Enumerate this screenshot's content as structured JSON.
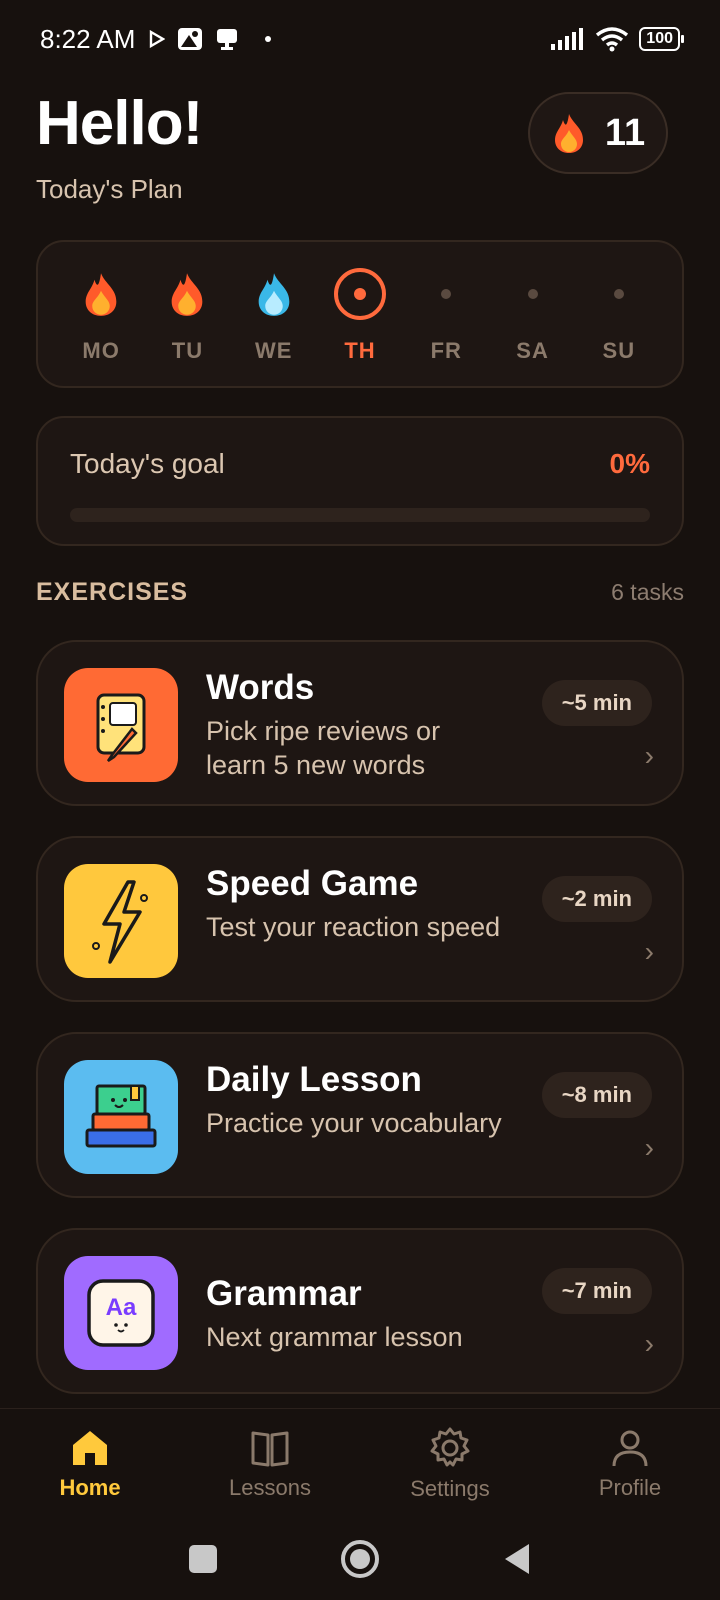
{
  "status_bar": {
    "time": "8:22 AM",
    "battery": "100"
  },
  "header": {
    "greeting": "Hello!",
    "subtitle": "Today's Plan",
    "streak_count": "11"
  },
  "week": {
    "days": [
      {
        "label": "MO",
        "state": "fire"
      },
      {
        "label": "TU",
        "state": "fire"
      },
      {
        "label": "WE",
        "state": "frozen"
      },
      {
        "label": "TH",
        "state": "today"
      },
      {
        "label": "FR",
        "state": "upcoming"
      },
      {
        "label": "SA",
        "state": "upcoming"
      },
      {
        "label": "SU",
        "state": "upcoming"
      }
    ]
  },
  "goal": {
    "label": "Today's goal",
    "percent_text": "0%",
    "progress": 0
  },
  "exercises_section": {
    "title": "EXERCISES",
    "count": "6 tasks"
  },
  "exercises": [
    {
      "name": "Words",
      "desc": "Pick ripe reviews or learn 5 new words",
      "time": "~5 min",
      "icon": "notebook-pencil-icon",
      "color": "#ff6a34"
    },
    {
      "name": "Speed Game",
      "desc": "Test your reaction speed",
      "time": "~2 min",
      "icon": "lightning-icon",
      "color": "#ffc83d"
    },
    {
      "name": "Daily Lesson",
      "desc": "Practice your vocabulary",
      "time": "~8 min",
      "icon": "book-stack-icon",
      "color": "#5bbcf0"
    },
    {
      "name": "Grammar",
      "desc": "Next grammar lesson",
      "time": "~7 min",
      "icon": "grammar-card-icon",
      "color": "#a06bff"
    }
  ],
  "chevron": "›",
  "nav": [
    {
      "label": "Home",
      "icon": "home-icon",
      "active": true
    },
    {
      "label": "Lessons",
      "icon": "book-icon",
      "active": false
    },
    {
      "label": "Settings",
      "icon": "gear-icon",
      "active": false
    },
    {
      "label": "Profile",
      "icon": "person-icon",
      "active": false
    }
  ],
  "colors": {
    "accent": "#ff6a3d",
    "nav_active": "#ffc93c",
    "background": "#17110e"
  }
}
